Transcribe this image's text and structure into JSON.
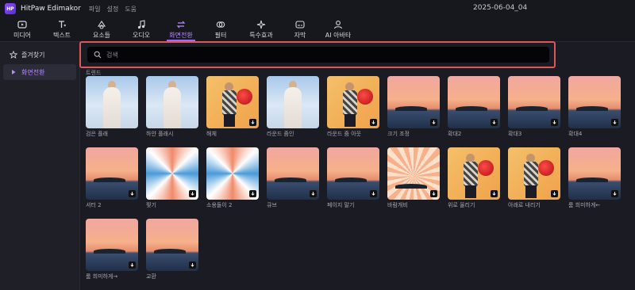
{
  "app": {
    "name": "HitPaw Edimakor",
    "logo_text": "HP",
    "menu": [
      "파일",
      "설정",
      "도움"
    ],
    "project_title": "2025-06-04_04"
  },
  "toolbar": [
    {
      "label": "미디어",
      "icon": "media-icon"
    },
    {
      "label": "텍스트",
      "icon": "text-icon"
    },
    {
      "label": "요소들",
      "icon": "elements-icon"
    },
    {
      "label": "오디오",
      "icon": "audio-icon"
    },
    {
      "label": "화면전환",
      "icon": "transition-icon",
      "active": true
    },
    {
      "label": "필터",
      "icon": "filter-icon"
    },
    {
      "label": "특수효과",
      "icon": "effects-icon"
    },
    {
      "label": "자막",
      "icon": "subtitle-icon"
    },
    {
      "label": "AI 아바타",
      "icon": "ai-avatar-icon"
    }
  ],
  "sidebar": {
    "items": [
      {
        "label": "즐겨찾기",
        "icon": "star-icon"
      },
      {
        "label": "화면전환",
        "icon": "triangle-right-icon",
        "active": true
      }
    ]
  },
  "search": {
    "placeholder": "검색",
    "value": ""
  },
  "section": {
    "label": "트렌드"
  },
  "transitions": [
    {
      "name": "검은 플래",
      "thumb": "bride",
      "download": false
    },
    {
      "name": "하얀 플래시",
      "thumb": "bride",
      "download": false
    },
    {
      "name": "해체",
      "thumb": "walker",
      "download": true
    },
    {
      "name": "라운드 줌인",
      "thumb": "bride",
      "download": false
    },
    {
      "name": "라운드 줌 아웃",
      "thumb": "walker",
      "download": true
    },
    {
      "name": "크기 조정",
      "thumb": "sunset",
      "download": true
    },
    {
      "name": "확대2",
      "thumb": "sunset",
      "download": true
    },
    {
      "name": "확대3",
      "thumb": "sunset",
      "download": true
    },
    {
      "name": "확대4",
      "thumb": "sunset",
      "download": true
    },
    {
      "name": "셔터 2",
      "thumb": "sunset",
      "download": true
    },
    {
      "name": "찢기",
      "thumb": "swirl",
      "download": true
    },
    {
      "name": "소용돌이 2",
      "thumb": "swirl",
      "download": true
    },
    {
      "name": "큐브",
      "thumb": "sunset",
      "download": true
    },
    {
      "name": "페이지 말기",
      "thumb": "sunset",
      "download": true
    },
    {
      "name": "바람개비",
      "thumb": "burst",
      "download": true
    },
    {
      "name": "위로 올리기",
      "thumb": "walker",
      "download": true
    },
    {
      "name": "아래로 내리기",
      "thumb": "walker",
      "download": true
    },
    {
      "name": "룸 희미하게←",
      "thumb": "sunset",
      "download": true
    },
    {
      "name": "룸 희미하게→",
      "thumb": "sunset",
      "download": true
    },
    {
      "name": "교환",
      "thumb": "sunset",
      "download": true
    }
  ]
}
